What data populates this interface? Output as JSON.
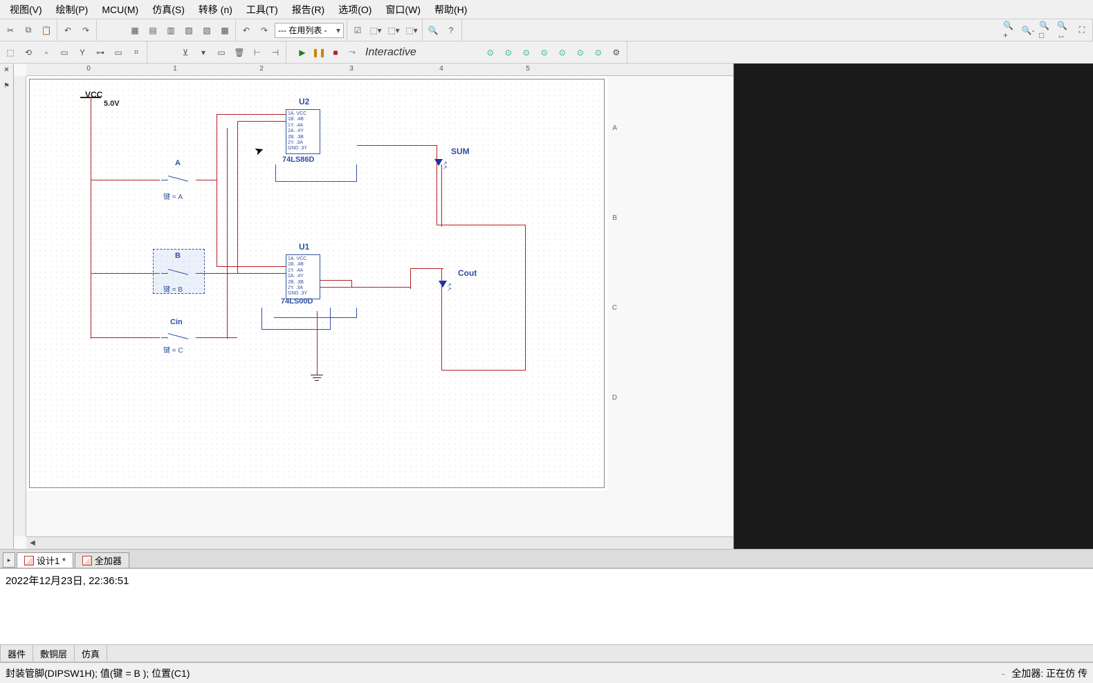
{
  "menu": {
    "view": "视图(V)",
    "draw": "绘制(P)",
    "mcu": "MCU(M)",
    "sim": "仿真(S)",
    "transfer": "转移 (n)",
    "tools": "工具(T)",
    "report": "报告(R)",
    "options": "选项(O)",
    "window": "窗口(W)",
    "help": "帮助(H)"
  },
  "toolbar1": {
    "dropdown_value": "--- 在用列表 -"
  },
  "sim_bar": {
    "mode_label": "Interactive"
  },
  "ruler_h": [
    "0",
    "1",
    "2",
    "3",
    "4",
    "5"
  ],
  "ruler_v_sections": [
    "A",
    "B",
    "C",
    "D"
  ],
  "schematic": {
    "vcc_label": "VCC",
    "vcc_value": "5.0V",
    "u2_ref": "U2",
    "u2_part": "74LS86D",
    "u2_pins": "1A. VCC\n1B. .4B\n1Y. .4A\n2A. .4Y\n2B. .3B\n2Y. .3A\nGND .3Y",
    "u1_ref": "U1",
    "u1_part": "74LS00D",
    "u1_pins": "1A. VCC\n1B. .4B\n1Y. .4A\n2A. .4Y\n2B. .3B\n2Y. .3A\nGND .3Y",
    "sw_a_label": "A",
    "sw_a_key": "键 = A",
    "sw_b_label": "B",
    "sw_b_key": "键 = B",
    "sw_c_label": "Cin",
    "sw_c_key": "键 = C",
    "led_sum_label": "SUM",
    "led_cout_label": "Cout"
  },
  "sheets": {
    "tab1": "设计1 *",
    "tab2": "全加器"
  },
  "log": {
    "line1": "2022年12月23日, 22:36:51"
  },
  "bottom_tabs": {
    "tab1": "器件",
    "tab2": "敷铜层",
    "tab3": "仿真"
  },
  "status": {
    "left": "封装管脚(DIPSW1H); 值(键 = B ); 位置(C1)",
    "dash": "-",
    "right": "全加器: 正在仿 传"
  }
}
